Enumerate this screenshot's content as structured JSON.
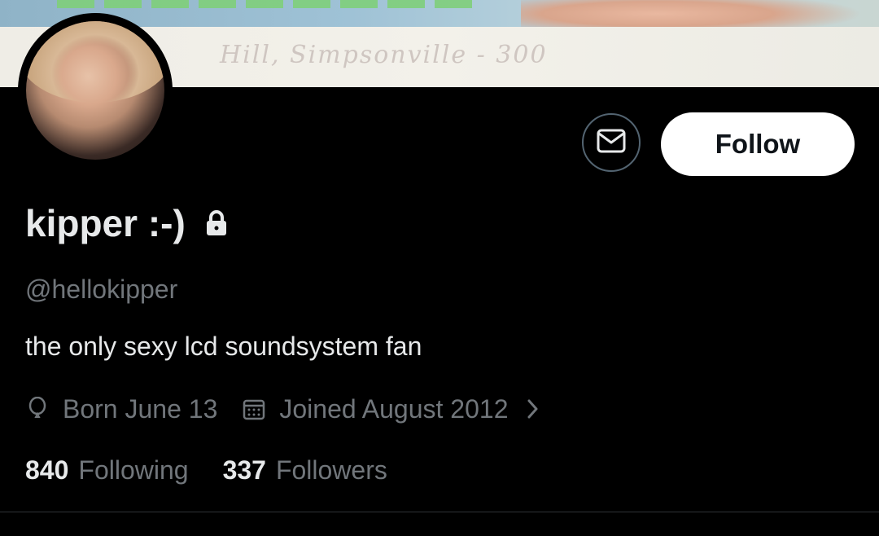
{
  "banner": {
    "script_text": "Hill, Simpsonville - 300"
  },
  "profile": {
    "display_name": "kipper :-)",
    "handle": "@hellokipper",
    "bio": "the only sexy lcd soundsystem fan",
    "birthday": "Born June 13",
    "joined": "Joined August 2012",
    "protected": true
  },
  "actions": {
    "follow_label": "Follow"
  },
  "stats": {
    "following_count": "840",
    "following_label": "Following",
    "followers_count": "337",
    "followers_label": "Followers"
  },
  "icons": {
    "message": "envelope-icon",
    "lock": "lock-icon",
    "birthday": "balloon-icon",
    "joined": "calendar-icon",
    "more": "chevron-right-icon"
  },
  "colors": {
    "background": "#000000",
    "primary_text": "#e7e9ea",
    "secondary_text": "#71767b",
    "follow_button_bg": "#ffffff",
    "follow_button_text": "#0f1419",
    "border": "#536471"
  }
}
